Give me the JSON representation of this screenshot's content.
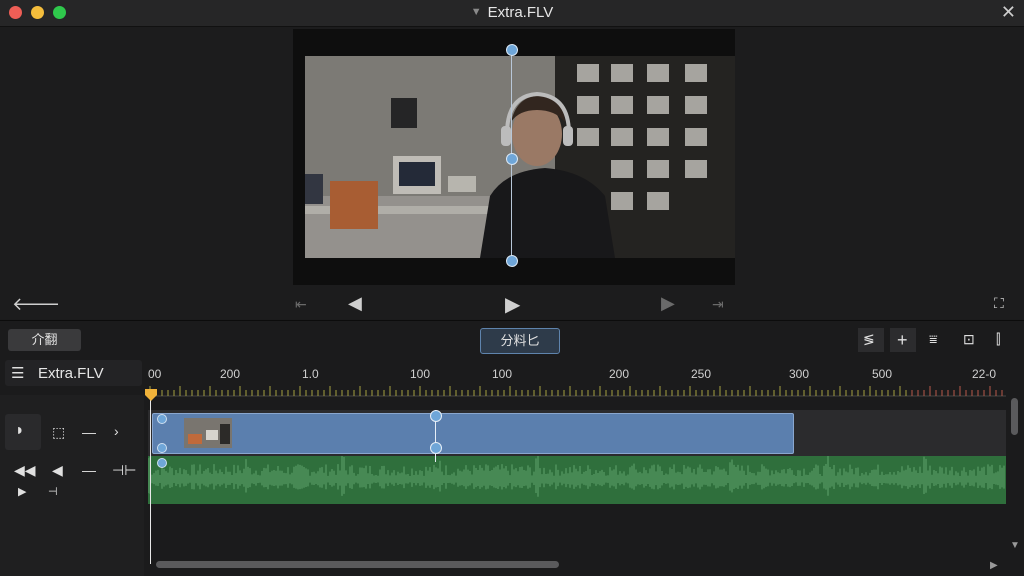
{
  "window": {
    "title": "Extra.FLV",
    "close_icon": "close-icon",
    "traffic_lights": [
      "#ee5e56",
      "#f4bd3c",
      "#2fc84c"
    ]
  },
  "viewer": {
    "back_icon": "arrow-left-icon",
    "fullscreen_icon": "fullscreen-icon",
    "transport": [
      "skip-to-start-icon",
      "step-back-icon",
      "play-icon",
      "step-forward-icon",
      "skip-to-end-icon"
    ]
  },
  "toolbar": {
    "left_button": "介翻",
    "center_button": "分料匕",
    "right_icons": [
      "audio-waves-icon",
      "add-icon",
      "filter-icon",
      "frame-icon",
      "split-icon"
    ]
  },
  "timeline": {
    "track_name": "Extra.FLV",
    "ruler_labels": [
      "00",
      "200",
      "1.0",
      "100",
      "100",
      "200",
      "250",
      "300",
      "500",
      "22-0"
    ],
    "video_clip_color": "#5b7fae",
    "audio_color": "#2f6f3c",
    "playhead_color": "#f0b23a"
  }
}
